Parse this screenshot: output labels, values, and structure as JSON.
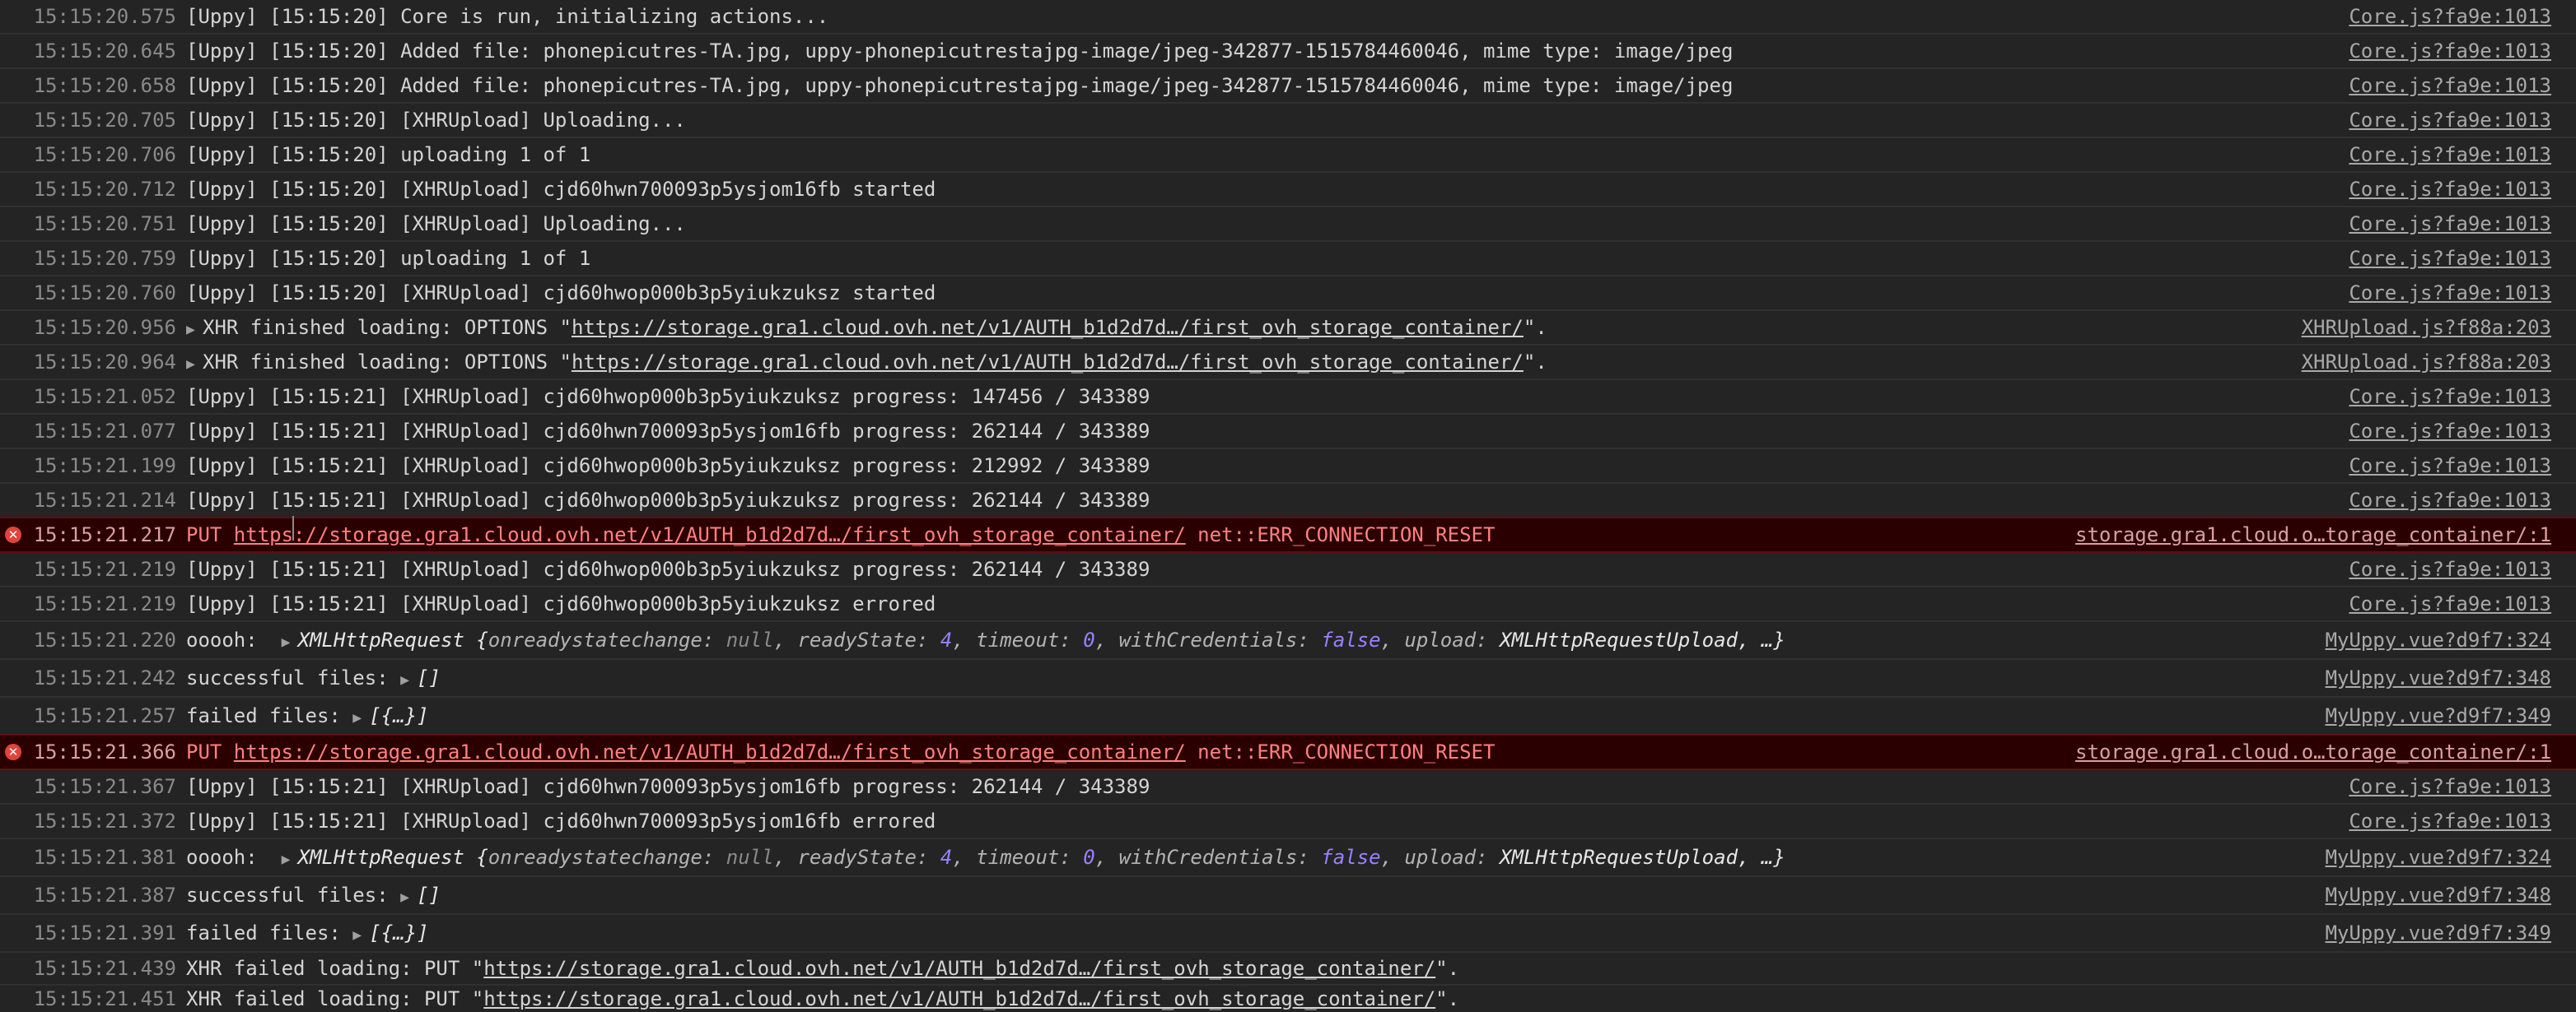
{
  "sources": {
    "core": "Core.js?fa9e:1013",
    "xhr": "XHRUpload.js?f88a:203",
    "storage": "storage.gra1.cloud.o…torage_container/:1",
    "vue324": "MyUppy.vue?d9f7:324",
    "vue348": "MyUppy.vue?d9f7:348",
    "vue349": "MyUppy.vue?d9f7:349"
  },
  "url": "https://storage.gra1.cloud.ovh.net/v1/AUTH_b1d2d7d…/first_ovh_storage_container/",
  "err_suffix": " net::ERR_CONNECTION_RESET",
  "xhr_obj": {
    "prefix": "ooooh:  ",
    "name": "XMLHttpRequest ",
    "open": "{",
    "k1": "onreadystatechange: ",
    "v1": "null",
    "k2": ", readyState: ",
    "v2": "4",
    "k3": ", timeout: ",
    "v3": "0",
    "k4": ", withCredentials: ",
    "v4": "false",
    "k5": ", upload: ",
    "v5": "XMLHttpRequestUpload",
    "close": ", …}"
  },
  "success_label": "successful files: ",
  "success_value": "[]",
  "failed_label": "failed files: ",
  "failed_value": "[{…}]",
  "put": "PUT ",
  "xhr_opt_prefix": "XHR finished loading: OPTIONS \"",
  "xhr_put_prefix": "XHR failed loading: PUT \"",
  "quote_end": "\".",
  "rows": [
    {
      "ts": "15:15:20.575",
      "text": "[Uppy] [15:15:20] Core is run, initializing actions..."
    },
    {
      "ts": "15:15:20.645",
      "text": "[Uppy] [15:15:20] Added file: phonepicutres-TA.jpg, uppy-phonepicutrestajpg-image/jpeg-342877-1515784460046, mime type: image/jpeg"
    },
    {
      "ts": "15:15:20.658",
      "text": "[Uppy] [15:15:20] Added file: phonepicutres-TA.jpg, uppy-phonepicutrestajpg-image/jpeg-342877-1515784460046, mime type: image/jpeg"
    },
    {
      "ts": "15:15:20.705",
      "text": "[Uppy] [15:15:20] [XHRUpload] Uploading..."
    },
    {
      "ts": "15:15:20.706",
      "text": "[Uppy] [15:15:20] uploading 1 of 1"
    },
    {
      "ts": "15:15:20.712",
      "text": "[Uppy] [15:15:20] [XHRUpload] cjd60hwn700093p5ysjom16fb started"
    },
    {
      "ts": "15:15:20.751",
      "text": "[Uppy] [15:15:20] [XHRUpload] Uploading..."
    },
    {
      "ts": "15:15:20.759",
      "text": "[Uppy] [15:15:20] uploading 1 of 1"
    },
    {
      "ts": "15:15:20.760",
      "text": "[Uppy] [15:15:20] [XHRUpload] cjd60hwop000b3p5yiukzuksz started"
    },
    {
      "ts": "15:15:20.956"
    },
    {
      "ts": "15:15:20.964"
    },
    {
      "ts": "15:15:21.052",
      "text": "[Uppy] [15:15:21] [XHRUpload] cjd60hwop000b3p5yiukzuksz progress: 147456 / 343389"
    },
    {
      "ts": "15:15:21.077",
      "text": "[Uppy] [15:15:21] [XHRUpload] cjd60hwn700093p5ysjom16fb progress: 262144 / 343389"
    },
    {
      "ts": "15:15:21.199",
      "text": "[Uppy] [15:15:21] [XHRUpload] cjd60hwop000b3p5yiukzuksz progress: 212992 / 343389"
    },
    {
      "ts": "15:15:21.214",
      "text": "[Uppy] [15:15:21] [XHRUpload] cjd60hwop000b3p5yiukzuksz progress: 262144 / 343389"
    },
    {
      "ts": "15:15:21.217"
    },
    {
      "ts": "15:15:21.219",
      "text": "[Uppy] [15:15:21] [XHRUpload] cjd60hwop000b3p5yiukzuksz progress: 262144 / 343389"
    },
    {
      "ts": "15:15:21.219",
      "text": "[Uppy] [15:15:21] [XHRUpload] cjd60hwop000b3p5yiukzuksz errored"
    },
    {
      "ts": "15:15:21.220"
    },
    {
      "ts": "15:15:21.242"
    },
    {
      "ts": "15:15:21.257"
    },
    {
      "ts": "15:15:21.366"
    },
    {
      "ts": "15:15:21.367",
      "text": "[Uppy] [15:15:21] [XHRUpload] cjd60hwn700093p5ysjom16fb progress: 262144 / 343389"
    },
    {
      "ts": "15:15:21.372",
      "text": "[Uppy] [15:15:21] [XHRUpload] cjd60hwn700093p5ysjom16fb errored"
    },
    {
      "ts": "15:15:21.381"
    },
    {
      "ts": "15:15:21.387"
    },
    {
      "ts": "15:15:21.391"
    },
    {
      "ts": "15:15:21.439"
    },
    {
      "ts": "15:15:21.451"
    }
  ]
}
